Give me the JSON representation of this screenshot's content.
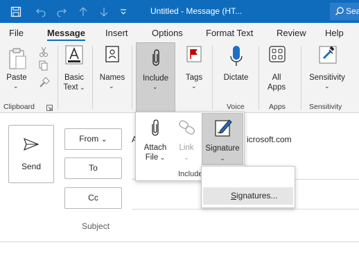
{
  "window": {
    "title": "Untitled  -  Message (HT...",
    "search_placeholder": "Search"
  },
  "tabs": [
    {
      "label": "File"
    },
    {
      "label": "Message"
    },
    {
      "label": "Insert"
    },
    {
      "label": "Options"
    },
    {
      "label": "Format Text"
    },
    {
      "label": "Review"
    },
    {
      "label": "Help"
    }
  ],
  "ribbon": {
    "paste": {
      "label": "Paste",
      "icon": "paste-icon"
    },
    "basic_text": {
      "label1": "Basic",
      "label2": "Text",
      "icon": "font-color-icon"
    },
    "names": {
      "label": "Names",
      "icon": "address-book-icon"
    },
    "include": {
      "label": "Include",
      "icon": "paperclip-icon"
    },
    "tags": {
      "label": "Tags",
      "icon": "flag-icon"
    },
    "dictate": {
      "label": "Dictate",
      "icon": "microphone-icon"
    },
    "all_apps": {
      "label1": "All",
      "label2": "Apps",
      "icon": "apps-grid-icon"
    },
    "sensitivity": {
      "label": "Sensitivity",
      "icon": "sensitivity-icon"
    },
    "groups": {
      "clipboard": "Clipboard",
      "voice": "Voice",
      "apps": "Apps",
      "sensitivity": "Sensitivity"
    }
  },
  "include_panel": {
    "attach_file": {
      "label1": "Attach",
      "label2": "File"
    },
    "link": {
      "label": "Link"
    },
    "signature": {
      "label": "Signature"
    },
    "group_label": "Include"
  },
  "signature_menu": {
    "item_prefix": "S",
    "item_rest": "ignatures..."
  },
  "compose": {
    "send_label": "Send",
    "from_label": "From",
    "from_partial": "A",
    "from_value_visible": "icrosoft.com",
    "to_label": "To",
    "cc_label": "Cc",
    "subject_label": "Subject"
  },
  "colors": {
    "titlebar": "#0f6cbd",
    "accent": "#0f6cbd",
    "ribbon_bg": "#f3f3f3",
    "pressed": "#cfcfcf"
  }
}
